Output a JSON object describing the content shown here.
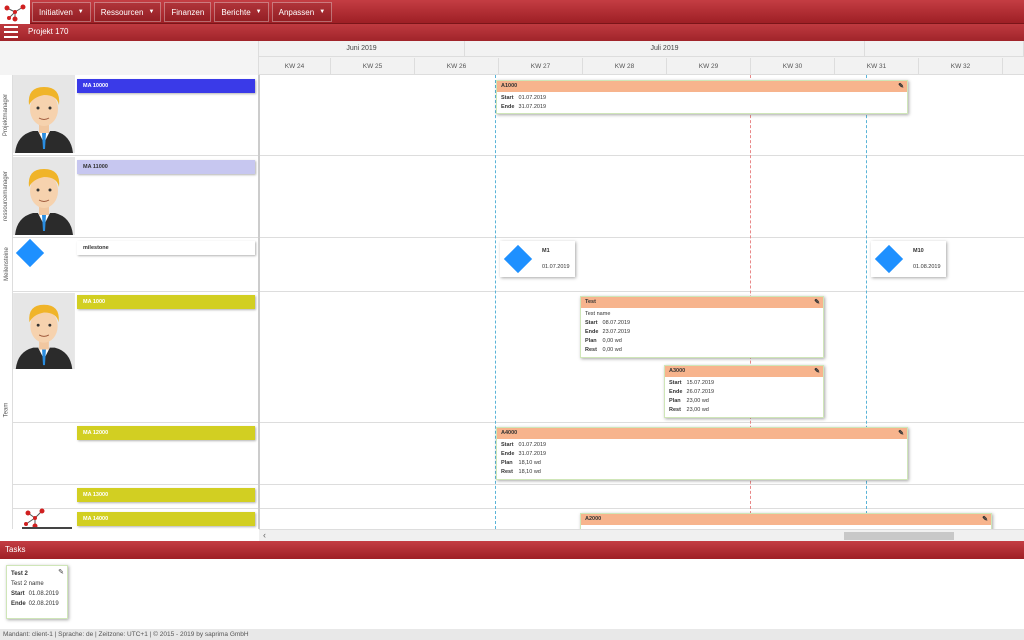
{
  "menu": {
    "items": [
      {
        "label": "Initiativen",
        "has_caret": true
      },
      {
        "label": "Ressourcen",
        "has_caret": true
      },
      {
        "label": "Finanzen",
        "has_caret": false
      },
      {
        "label": "Berichte",
        "has_caret": true
      },
      {
        "label": "Anpassen",
        "has_caret": true
      }
    ]
  },
  "project": {
    "title": "Projekt 170"
  },
  "timeline": {
    "months": [
      "Juni 2019",
      "Juli 2019"
    ],
    "weeks": [
      "KW 24",
      "KW 25",
      "KW 26",
      "KW 27",
      "KW 28",
      "KW 29",
      "KW 30",
      "KW 31",
      "KW 32"
    ]
  },
  "groups": [
    "Projektmanager",
    "ressourcemanager",
    "Meilensteine",
    "Team"
  ],
  "resources": [
    {
      "label": "MA 10000",
      "color": "#3a3ae8",
      "text_color": "#ffffff"
    },
    {
      "label": "MA 11000",
      "color": "#c7c7f0",
      "text_color": "#333333"
    },
    {
      "label": "milestone",
      "color": "#ffffff",
      "text_color": "#333333"
    },
    {
      "label": "MA 1000",
      "color": "#d2cf22",
      "text_color": "#ffffff"
    },
    {
      "label": "MA 12000",
      "color": "#d2cf22",
      "text_color": "#ffffff"
    },
    {
      "label": "MA 13000",
      "color": "#d2cf22",
      "text_color": "#ffffff"
    },
    {
      "label": "MA 14000",
      "color": "#d2cf22",
      "text_color": "#ffffff"
    }
  ],
  "labels": {
    "start": "Start",
    "end": "Ende",
    "plan": "Plan",
    "rest": "Rest"
  },
  "tasks": [
    {
      "name": "A1000",
      "start": "01.07.2019",
      "end": "31.07.2019"
    },
    {
      "name": "Test",
      "subtitle": "Test name",
      "start": "08.07.2019",
      "end": "23.07.2019",
      "plan": "0,00 wd",
      "rest": "0,00 wd"
    },
    {
      "name": "A3000",
      "start": "15.07.2019",
      "end": "26.07.2019",
      "plan": "23,00 wd",
      "rest": "23,00 wd"
    },
    {
      "name": "A4000",
      "start": "01.07.2019",
      "end": "31.07.2019",
      "plan": "18,10 wd",
      "rest": "18,10 wd"
    },
    {
      "name": "A2000"
    }
  ],
  "milestones": [
    {
      "name": "M1",
      "date": "01.07.2019"
    },
    {
      "name": "M10",
      "date": "01.08.2019"
    }
  ],
  "tasks_panel": {
    "title": "Tasks",
    "card": {
      "name": "Test 2",
      "subtitle": "Test 2 name",
      "start": "01.08.2019",
      "end": "02.08.2019"
    }
  },
  "footer": {
    "text": "Mandant: client-1 | Sprache: de | Zeitzone: UTC+1 | © 2015 - 2019 by saprima GmbH"
  },
  "colors": {
    "brand": "#b02a30",
    "task_header": "#f7b48d",
    "milestone": "#1e90ff",
    "today_line": "#e88888",
    "range_line": "#5ab4d8"
  }
}
